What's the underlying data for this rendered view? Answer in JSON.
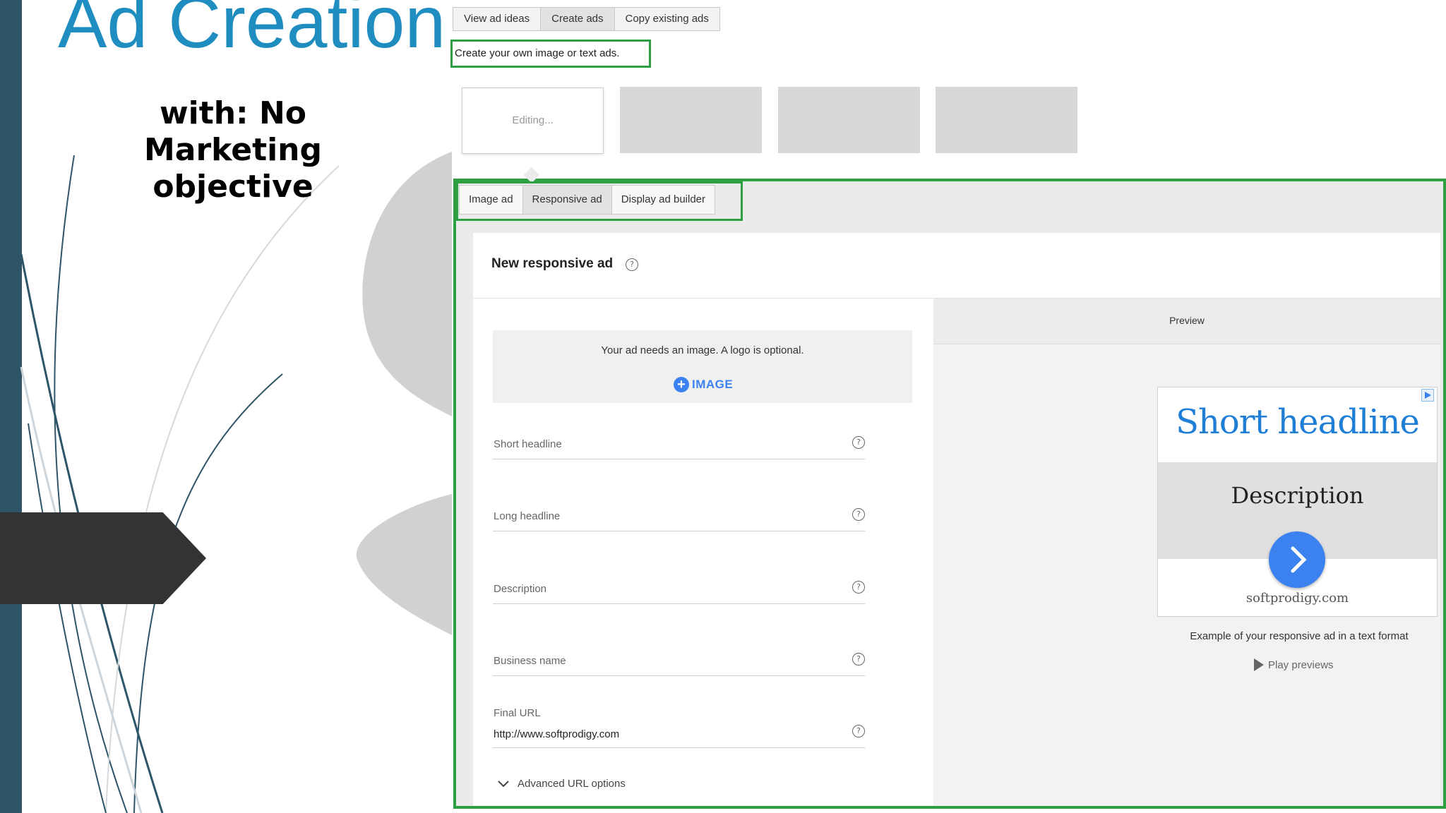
{
  "slide": {
    "title": "Ad Creation",
    "subtitle": "with: No Marketing objective"
  },
  "top_tabs": [
    {
      "label": "View ad ideas",
      "active": false
    },
    {
      "label": "Create ads",
      "active": true
    },
    {
      "label": "Copy existing ads",
      "active": false
    }
  ],
  "instruction": "Create your own image or text ads.",
  "thumbnails": {
    "editing_label": "Editing..."
  },
  "ad_type_tabs": [
    {
      "label": "Image ad",
      "active": false
    },
    {
      "label": "Responsive ad",
      "active": true
    },
    {
      "label": "Display ad builder",
      "active": false
    }
  ],
  "card": {
    "title": "New responsive ad",
    "help_icon": "?"
  },
  "image_section": {
    "message": "Your ad needs an image. A logo is optional.",
    "add_button_label": "IMAGE",
    "add_button_icon": "+"
  },
  "form": {
    "short_headline_label": "Short headline",
    "long_headline_label": "Long headline",
    "description_label": "Description",
    "business_name_label": "Business name",
    "final_url_label": "Final URL",
    "final_url_value": "http://www.softprodigy.com",
    "advanced_label": "Advanced URL options",
    "advanced_icon": "chevron-down-icon"
  },
  "preview": {
    "header": "Preview",
    "ad_headline": "Short headline",
    "ad_description": "Description",
    "ad_domain": "softprodigy.com",
    "example_text": "Example of your responsive ad in a text format",
    "play_label": "Play previews"
  },
  "colors": {
    "accent_blue": "#3b82f0",
    "highlight_green": "#2ea043",
    "title_blue": "#1f8dbf",
    "slide_bar": "#2e5468"
  }
}
